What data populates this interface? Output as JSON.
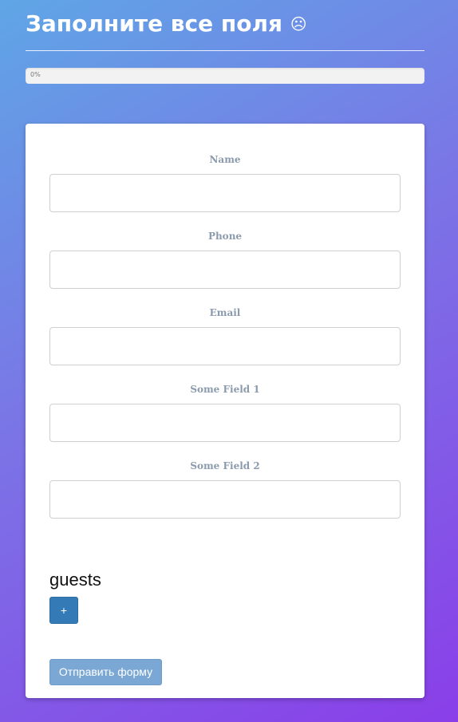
{
  "header": {
    "title": "Заполните все поля",
    "status_glyph": "☹"
  },
  "progress": {
    "value_percent": 0,
    "label": "0%"
  },
  "form": {
    "fields": [
      {
        "label": "Name",
        "value": "",
        "placeholder": ""
      },
      {
        "label": "Phone",
        "value": "",
        "placeholder": ""
      },
      {
        "label": "Email",
        "value": "",
        "placeholder": ""
      },
      {
        "label": "Some Field 1",
        "value": "",
        "placeholder": ""
      },
      {
        "label": "Some Field 2",
        "value": "",
        "placeholder": ""
      }
    ],
    "guests_title": "guests",
    "add_guest_label": "+",
    "submit_label": "Отправить форму"
  },
  "colors": {
    "primary": "#337ab7",
    "submit_disabled": "#7aa7d3",
    "label_text": "#8b9bad",
    "gradient_start": "#5fa6e6",
    "gradient_end": "#8a3ee8"
  }
}
